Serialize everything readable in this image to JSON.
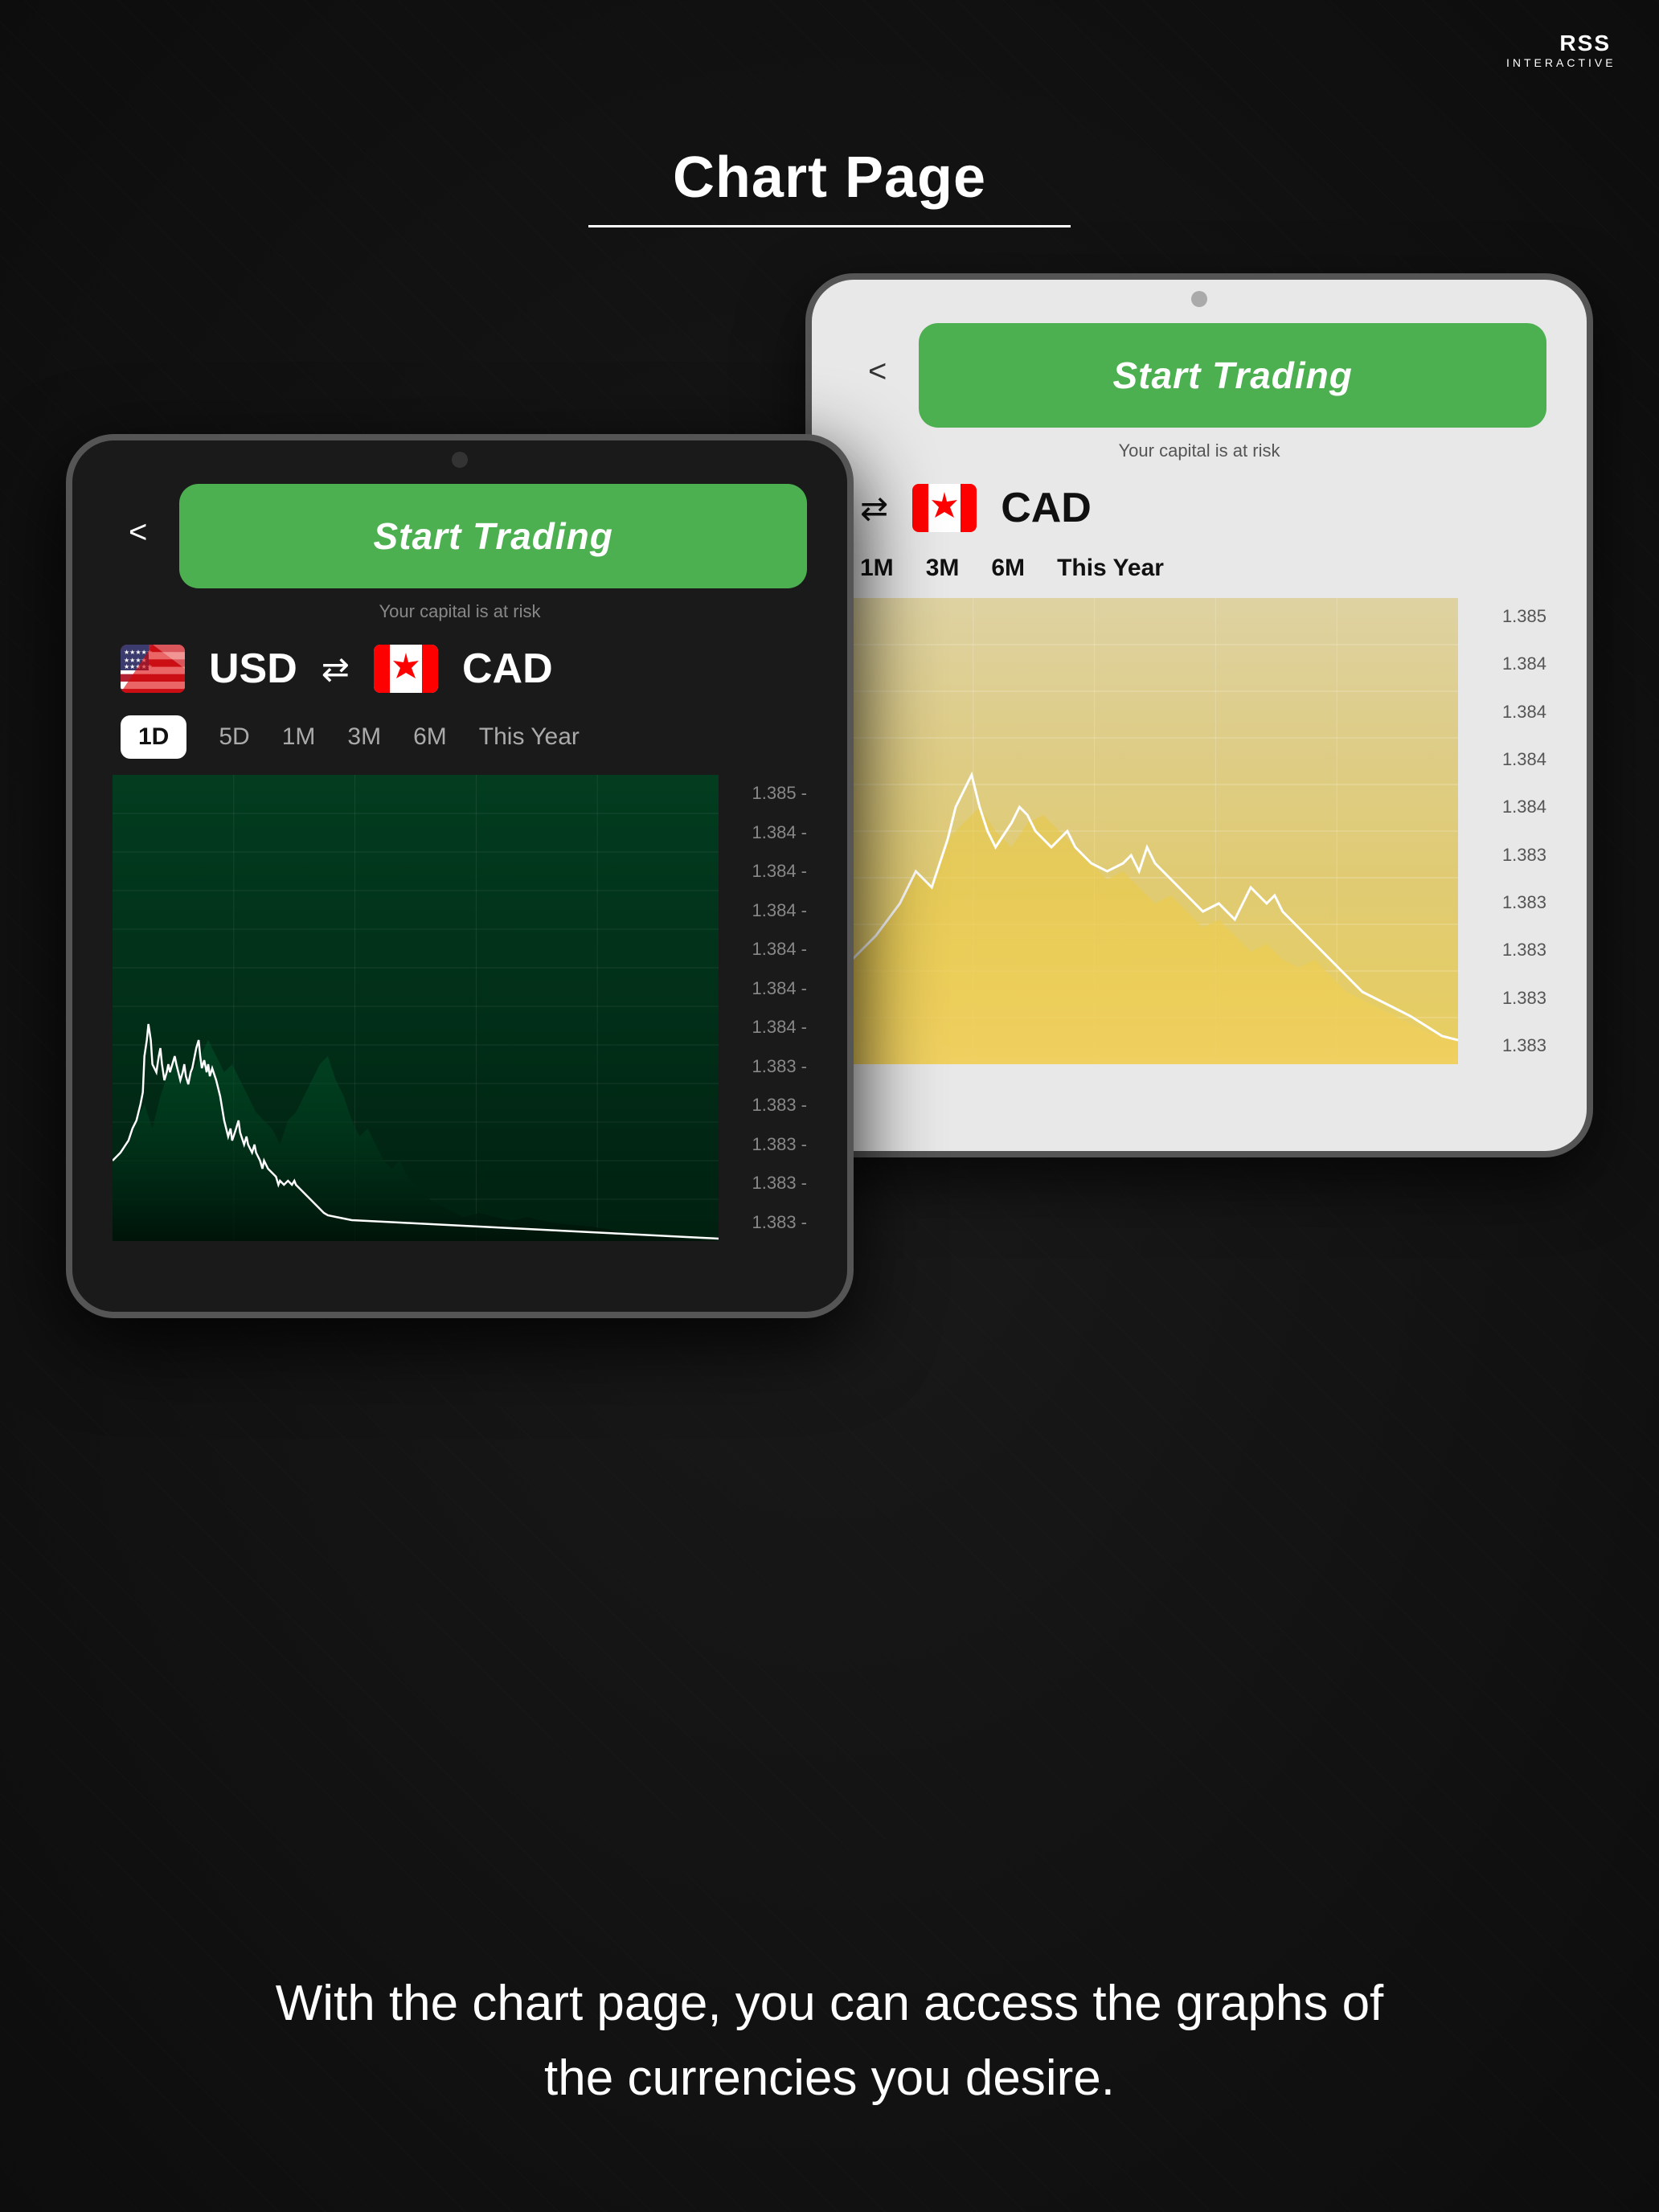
{
  "logo": {
    "main": "RSS",
    "sub": "INTERACTIVE"
  },
  "page": {
    "title": "Chart Page",
    "description": "With the chart page, you can access the graphs of the currencies you desire."
  },
  "front_tablet": {
    "back_btn": "<",
    "start_trading": "Start Trading",
    "risk_text": "Your capital is at risk",
    "currency_from": "USD",
    "currency_to": "CAD",
    "time_tabs": [
      "1D",
      "5D",
      "1M",
      "3M",
      "6M",
      "This Year"
    ],
    "active_tab": "1D",
    "chart_labels": [
      "1.385 -",
      "1.384 -",
      "1.384 -",
      "1.384 -",
      "1.384 -",
      "1.384 -",
      "1.384 -",
      "1.383 -",
      "1.383 -",
      "1.383 -",
      "1.383 -",
      "1.383 -"
    ]
  },
  "back_tablet": {
    "back_btn": "<",
    "start_trading": "Start Trading",
    "risk_text": "Your capital is at risk",
    "currency_to": "CAD",
    "time_tabs": [
      "1M",
      "3M",
      "6M",
      "This Year"
    ],
    "chart_labels": [
      "1.385",
      "1.384",
      "1.384",
      "1.384",
      "1.384",
      "1.383",
      "1.383",
      "1.383",
      "1.383",
      "1.383"
    ]
  }
}
